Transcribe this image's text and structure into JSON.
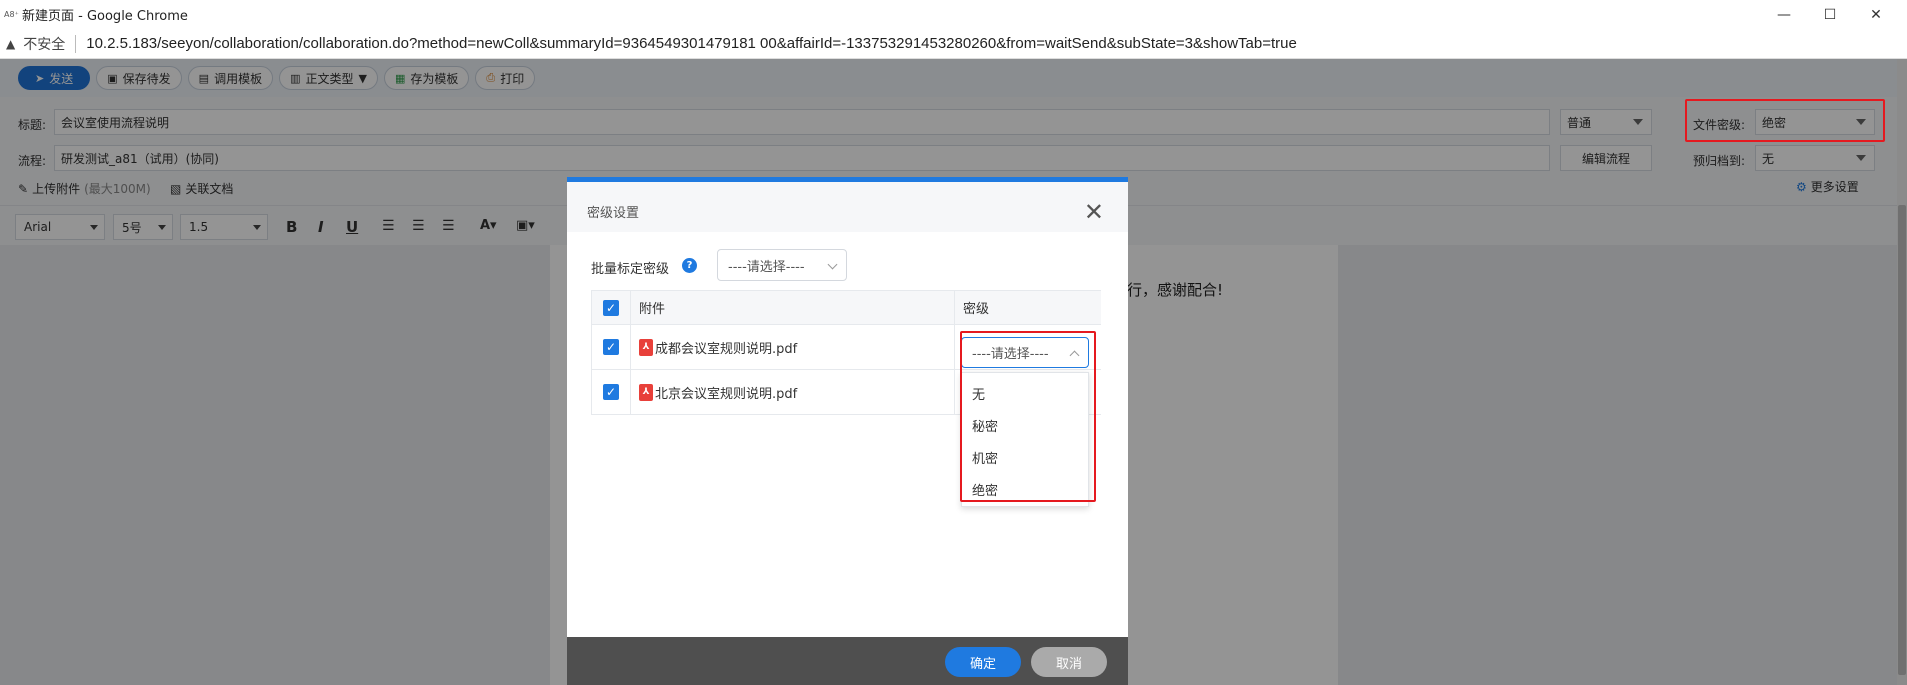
{
  "window": {
    "app_icon_text": "A8⁺",
    "title": "新建页面 - Google Chrome",
    "minimize": "—",
    "maximize": "☐",
    "close": "✕"
  },
  "address": {
    "warning_icon": "▲",
    "insecure_label": "不安全",
    "url": "10.2.5.183/seeyon/collaboration/collaboration.do?method=newColl&summaryId=9364549301479181 00&affairId=-133753291453280260&from=waitSend&subState=3&showTab=true"
  },
  "toolbar": {
    "send": "发送",
    "save_draft": "保存待发",
    "call_template": "调用模板",
    "body_type": "正文类型",
    "save_template": "存为模板",
    "print": "打印"
  },
  "form": {
    "title_label": "标题:",
    "title_value": "会议室使用流程说明",
    "priority_value": "普通",
    "doc_level_label": "文件密级:",
    "doc_level_value": "绝密",
    "flow_label": "流程:",
    "flow_value": "研发测试_a81（试用）(协同)",
    "edit_flow": "编辑流程",
    "archive_label": "预归档到:",
    "archive_value": "无",
    "upload_attachment": "上传附件",
    "upload_limit": "(最大100M)",
    "related_doc": "关联文档",
    "more_settings": "更多设置"
  },
  "editor": {
    "font": "Arial",
    "size": "5号",
    "line_height": "1.5",
    "bold": "B",
    "italic": "I",
    "underline": "U",
    "doc_text": "行，感谢配合!"
  },
  "dialog": {
    "title": "密级设置",
    "close": "✕",
    "batch_label": "批量标定密级",
    "help": "?",
    "batch_placeholder": "----请选择----",
    "col_attachment": "附件",
    "col_level": "密级",
    "rows": [
      {
        "name": "成都会议室规则说明.pdf"
      },
      {
        "name": "北京会议室规则说明.pdf"
      }
    ],
    "level_placeholder": "----请选择----",
    "level_options": [
      "无",
      "秘密",
      "机密",
      "绝密"
    ],
    "ok": "确定",
    "cancel": "取消"
  },
  "colors": {
    "primary": "#1f7ae0",
    "highlight": "#e5191f",
    "footer": "#4f4f4f"
  }
}
